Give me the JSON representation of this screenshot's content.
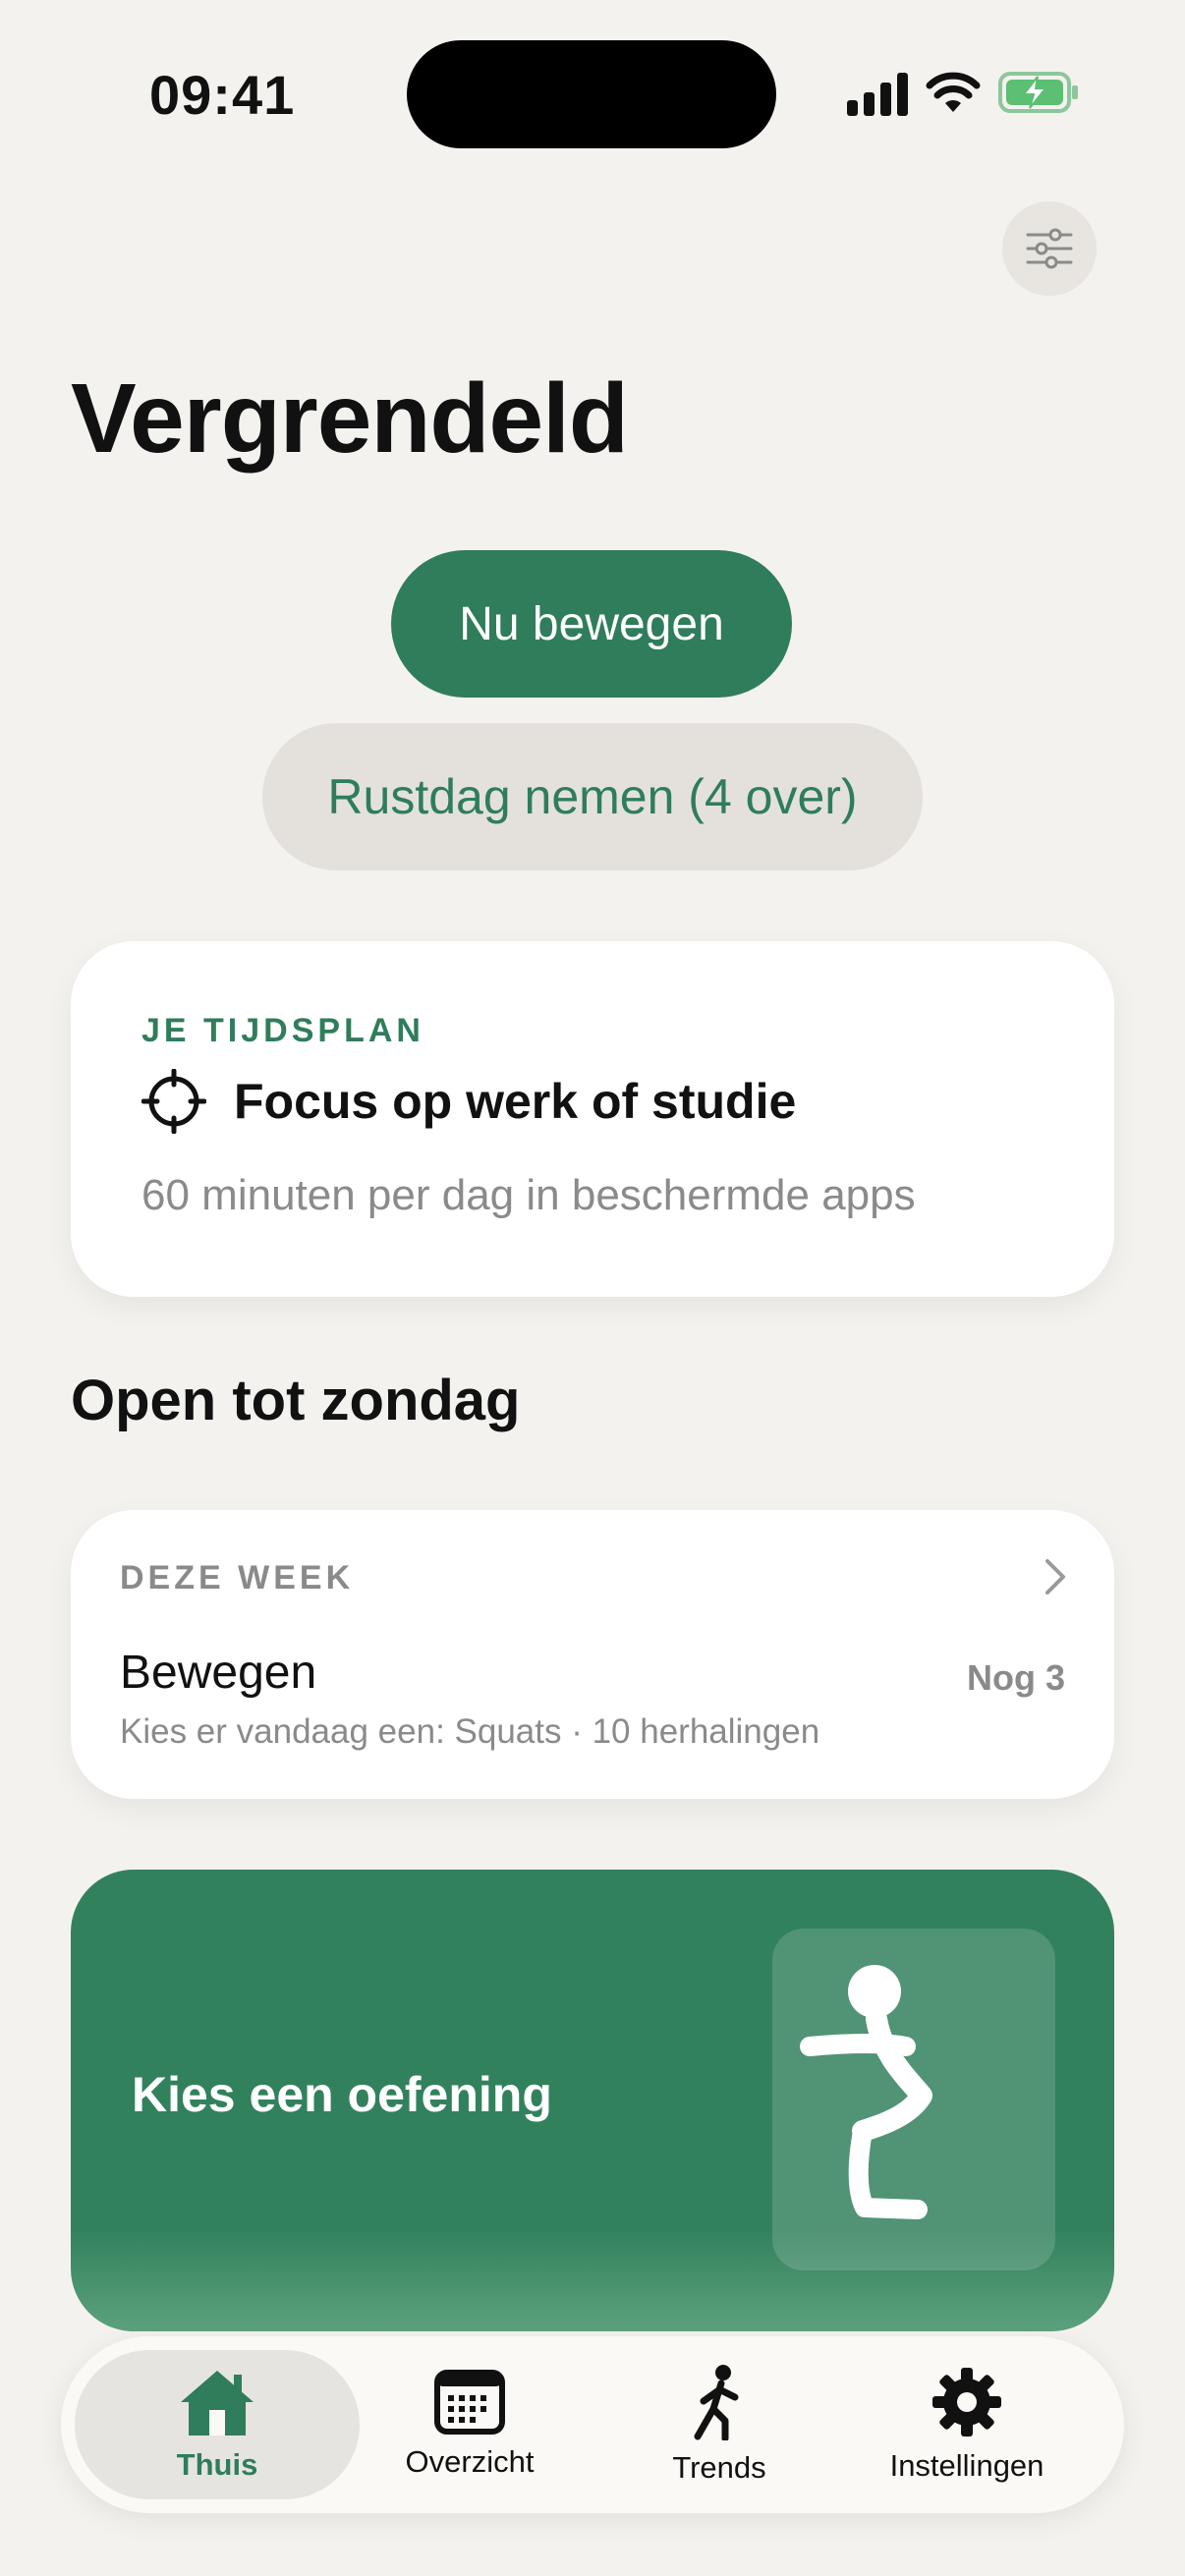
{
  "status_bar": {
    "time": "09:41"
  },
  "page": {
    "title": "Vergrendeld"
  },
  "actions": {
    "primary_label": "Nu bewegen",
    "secondary_label": "Rustdag nemen (4 over)"
  },
  "schedule_card": {
    "label": "JE TIJDSPLAN",
    "title": "Focus op werk of studie",
    "subtitle": "60 minuten per dag in beschermde apps"
  },
  "section": {
    "heading": "Open tot zondag"
  },
  "week_card": {
    "label": "DEZE WEEK",
    "title": "Bewegen",
    "count": "Nog 3",
    "subtitle": "Kies er vandaag een: Squats · 10 herhalingen"
  },
  "exercise_card": {
    "label": "Kies een oefening"
  },
  "tab_bar": {
    "tabs": [
      {
        "label": "Thuis",
        "icon": "house-icon",
        "active": true
      },
      {
        "label": "Overzicht",
        "icon": "calendar-icon",
        "active": false
      },
      {
        "label": "Trends",
        "icon": "walking-person-icon",
        "active": false
      },
      {
        "label": "Instellingen",
        "icon": "gear-icon",
        "active": false
      }
    ]
  },
  "colors": {
    "accent": "#2f7d5a",
    "background": "#f4f2ee",
    "muted": "#8a8a8a"
  }
}
